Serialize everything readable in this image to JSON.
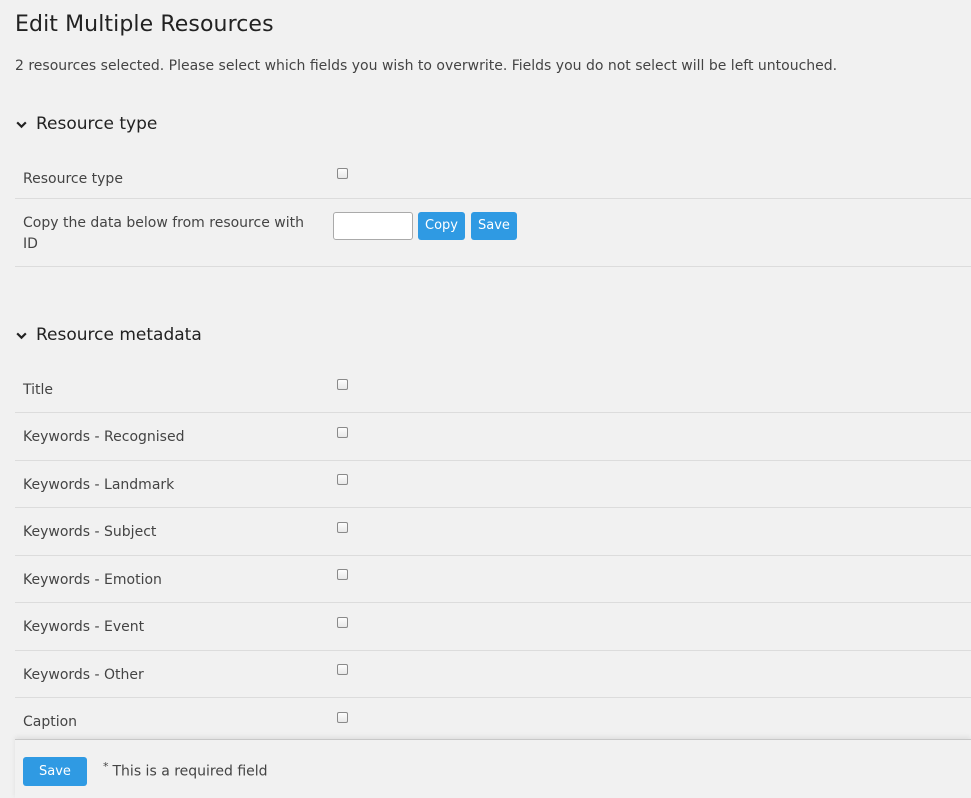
{
  "page": {
    "title": "Edit Multiple Resources",
    "intro": "2 resources selected. Please select which fields you wish to overwrite. Fields you do not select will be left untouched."
  },
  "sections": {
    "resource_type": {
      "title": "Resource type",
      "field_label": "Resource type",
      "copy_label": "Copy the data below from resource with ID",
      "copy_input_value": "",
      "copy_button": "Copy",
      "save_button": "Save"
    },
    "resource_metadata": {
      "title": "Resource metadata",
      "fields": [
        "Title",
        "Keywords - Recognised",
        "Keywords - Landmark",
        "Keywords - Subject",
        "Keywords - Emotion",
        "Keywords - Event",
        "Keywords - Other",
        "Caption"
      ]
    }
  },
  "footer": {
    "save_button": "Save",
    "required_asterisk": "*",
    "required_note": "This is a required field"
  },
  "colors": {
    "accent": "#2f9ae3",
    "background": "#f1f1f1"
  },
  "icons": {
    "section_toggle": "chevron-down-icon"
  }
}
